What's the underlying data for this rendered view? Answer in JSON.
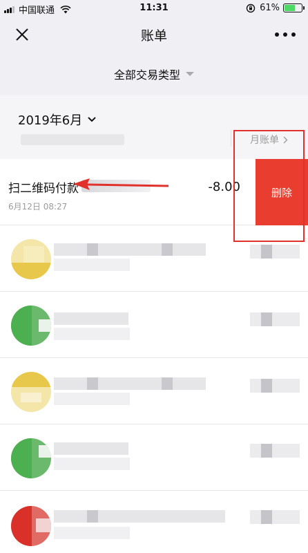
{
  "status_bar": {
    "carrier": "中国联通",
    "time": "11:31",
    "battery": "61%",
    "battery_level": 0.61
  },
  "nav": {
    "title": "账单",
    "close_icon": "close-icon",
    "more_icon": "more-icon"
  },
  "filter": {
    "label": "全部交易类型"
  },
  "month": {
    "label": "2019年6月",
    "bill_link": "月账单"
  },
  "transactions": [
    {
      "name": "扫二维码付款",
      "date": "6月12日 08:27",
      "amount": "-8.00",
      "delete_label": "删除"
    },
    {
      "avatar_color": "#e8c84a"
    },
    {
      "avatar_color": "#4caf50"
    },
    {
      "avatar_color": "#e8c84a"
    },
    {
      "avatar_color": "#4caf50"
    },
    {
      "avatar_color": "#d9302a"
    }
  ],
  "colors": {
    "background": "#efeff4",
    "delete": "#e93e2f",
    "annotation": "#e1312d"
  }
}
